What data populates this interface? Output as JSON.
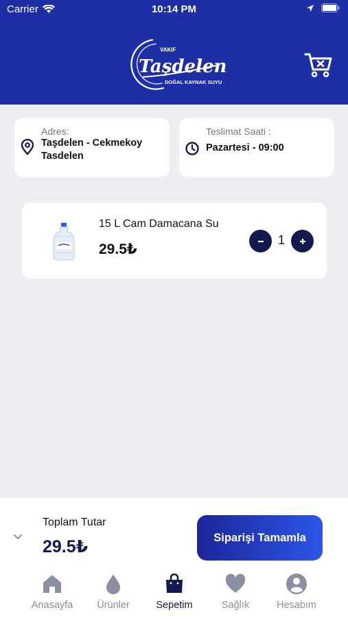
{
  "status_bar": {
    "carrier": "Carrier",
    "time": "10:14 PM"
  },
  "brand": {
    "top": "VAKIF",
    "name": "Taşdelen",
    "tagline": "DOĞAL KAYNAK SUYU"
  },
  "address": {
    "label": "Adres:",
    "value": "Taşdelen - Cekmekoy Tasdelen"
  },
  "delivery": {
    "label": "Teslimat Saati :",
    "value": "Pazartesi - 09:00"
  },
  "cart": {
    "items": [
      {
        "name": "15 L Cam Damacana Su",
        "price": "29.5₺",
        "quantity": "1"
      }
    ]
  },
  "summary": {
    "total_label": "Toplam Tutar",
    "total_value": "29.5₺",
    "checkout_label": "Siparişi Tamamla"
  },
  "tab_bar": {
    "items": [
      {
        "label": "Anasayfa",
        "icon": "home-icon",
        "active": false
      },
      {
        "label": "Ürünler",
        "icon": "drop-icon",
        "active": false
      },
      {
        "label": "Sepetim",
        "icon": "bag-icon",
        "active": true
      },
      {
        "label": "Sağlık",
        "icon": "heart-icon",
        "active": false
      },
      {
        "label": "Hesabım",
        "icon": "user-icon",
        "active": false
      }
    ]
  },
  "colors": {
    "brand_blue": "#1e2fa6",
    "navy": "#121a4e",
    "inactive": "#8a8fa4",
    "background": "#eceef2"
  }
}
